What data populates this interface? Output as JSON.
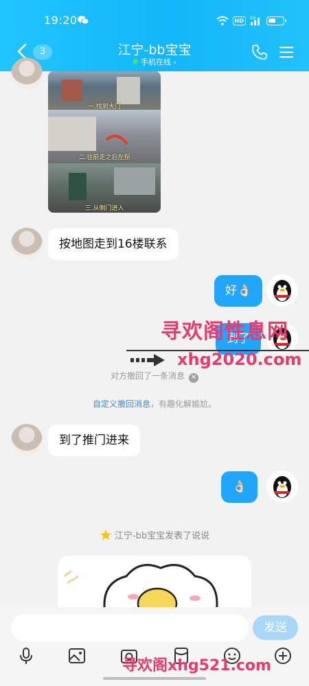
{
  "status_bar": {
    "time": "19:20",
    "hd_label": "HD",
    "signal_label": "5G"
  },
  "header": {
    "unread_count": "3",
    "contact_name": "江宁-bb宝宝",
    "online_status": "手机在线 ›"
  },
  "photo_captions": [
    "一.找到大门",
    "二.往前走之后左拐",
    "三.从侧门进入"
  ],
  "messages": {
    "m1": "按地图走到16楼联系",
    "m2": "好👌🏻",
    "m3": "到了",
    "m4": "到了推门进来",
    "m5": "👌🏻"
  },
  "system": {
    "recalled": "对方撤回了一条消息",
    "custom_link": "自定义撤回消息",
    "custom_rest": "，有趣化解尴尬。",
    "post_notice": "江宁-bb宝宝发表了说说"
  },
  "watermarks": {
    "w1": "寻欢阁性息网",
    "w2": "xhg2020.com",
    "w3": "寻欢阁xhg521.com"
  },
  "input": {
    "placeholder": "",
    "send_label": "发送"
  },
  "colors": {
    "header": "#13b6f8",
    "my_bubble": "#1fa7ff",
    "watermark": "#e83a6c"
  }
}
